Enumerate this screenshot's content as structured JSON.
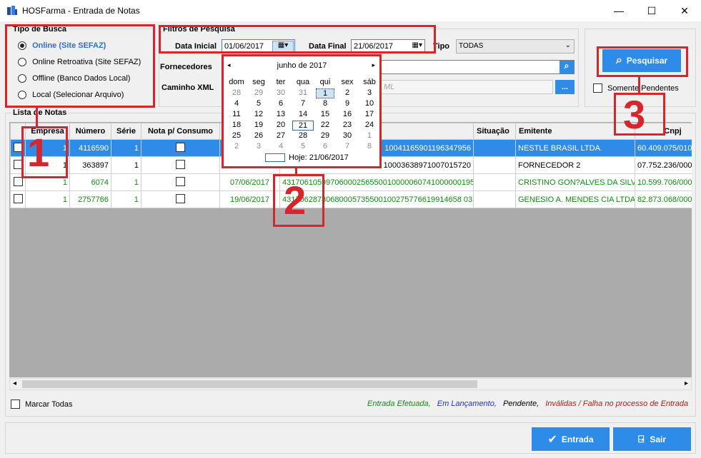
{
  "window": {
    "title": "HOSFarma - Entrada de Notas",
    "minimize": "—",
    "maximize": "☐",
    "close": "✕"
  },
  "tipo_busca": {
    "title": "Tipo de Busca",
    "options": [
      "Online (Site SEFAZ)",
      "Online Retroativa (Site SEFAZ)",
      "Offline (Banco Dados Local)",
      "Local (Selecionar Arquivo)"
    ],
    "selected": 0
  },
  "filtros": {
    "title": "Filtros de Pesquisa",
    "data_inicial_label": "Data Inicial",
    "data_inicial_value": "01/06/2017",
    "data_final_label": "Data Final",
    "data_final_value": "21/06/2017",
    "tipo_label": "Tipo",
    "tipo_value": "TODAS",
    "fornecedores_label": "Fornecedores",
    "caminho_label": "Caminho XML",
    "caminho_placeholder": "ML",
    "browse_label": "..."
  },
  "pesquisar": {
    "label": "Pesquisar",
    "somente_pendentes": "Somente Pendentes"
  },
  "calendar": {
    "month_label": "junho de 2017",
    "weekdays": [
      "dom",
      "seg",
      "ter",
      "qua",
      "qui",
      "sex",
      "sáb"
    ],
    "weeks": [
      [
        "28",
        "29",
        "30",
        "31",
        "1",
        "2",
        "3"
      ],
      [
        "4",
        "5",
        "6",
        "7",
        "8",
        "9",
        "10"
      ],
      [
        "11",
        "12",
        "13",
        "14",
        "15",
        "16",
        "17"
      ],
      [
        "18",
        "19",
        "20",
        "21",
        "22",
        "23",
        "24"
      ],
      [
        "25",
        "26",
        "27",
        "28",
        "29",
        "30",
        "1"
      ],
      [
        "2",
        "3",
        "4",
        "5",
        "6",
        "7",
        "8"
      ]
    ],
    "today_label": "Hoje: 21/06/2017"
  },
  "lista": {
    "title": "Lista de Notas",
    "columns": [
      "",
      "Empresa",
      "Número",
      "Série",
      "Nota p/ Consumo",
      "",
      "",
      "Situação",
      "Emitente",
      "Cnpj"
    ],
    "rows": [
      {
        "empresa": "1",
        "numero": "4116590",
        "serie": "1",
        "data": "",
        "chave": "10041165901196347956",
        "situacao": "",
        "emitente": "NESTLE BRASIL LTDA.",
        "cnpj": "60.409.075/010"
      },
      {
        "empresa": "1",
        "numero": "363897",
        "serie": "1",
        "data": "",
        "chave": "10003638971007015720",
        "situacao": "",
        "emitente": "FORNECEDOR 2",
        "cnpj": "07.752.236/000"
      },
      {
        "empresa": "1",
        "numero": "6074",
        "serie": "1",
        "data": "07/06/2017",
        "chave": "43170610599706000256550010000060741000000195",
        "situacao": "",
        "emitente": "CRISTINO GON?ALVES DA SILVA",
        "cnpj": "10.599.706/000"
      },
      {
        "empresa": "1",
        "numero": "2757766",
        "serie": "1",
        "data": "19/06/2017",
        "chave": "43170628730680005735500100275776619914658 03",
        "situacao": "",
        "emitente": "GENESIO A. MENDES CIA LTDA",
        "cnpj": "82.873.068/000"
      }
    ]
  },
  "footer": {
    "marcar_todas": "Marcar Todas",
    "legend_efetuada": "Entrada Efetuada,",
    "legend_lancamento": "Em Lançamento,",
    "legend_pendente": "Pendente,",
    "legend_invalidas": "Inválidas / Falha no processo de Entrada",
    "entrada": "Entrada",
    "sair": "Sair"
  },
  "annotations": [
    "1",
    "2",
    "3"
  ],
  "colors": {
    "accent": "#2f8be8",
    "annotation": "#d6262b",
    "green": "#128c12"
  }
}
